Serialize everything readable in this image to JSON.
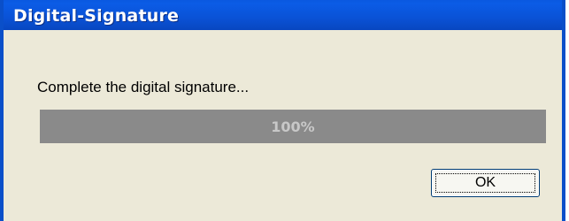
{
  "window": {
    "title": "Digital-Signature",
    "colors": {
      "title_bar": "#0a52d6",
      "window_body": "#ece9d8",
      "progress_fill": "#8a8a8a"
    }
  },
  "dialog": {
    "message": "Complete the digital signature...",
    "progress": {
      "value_percent": 100,
      "label": "100%"
    },
    "ok_label": "OK"
  }
}
